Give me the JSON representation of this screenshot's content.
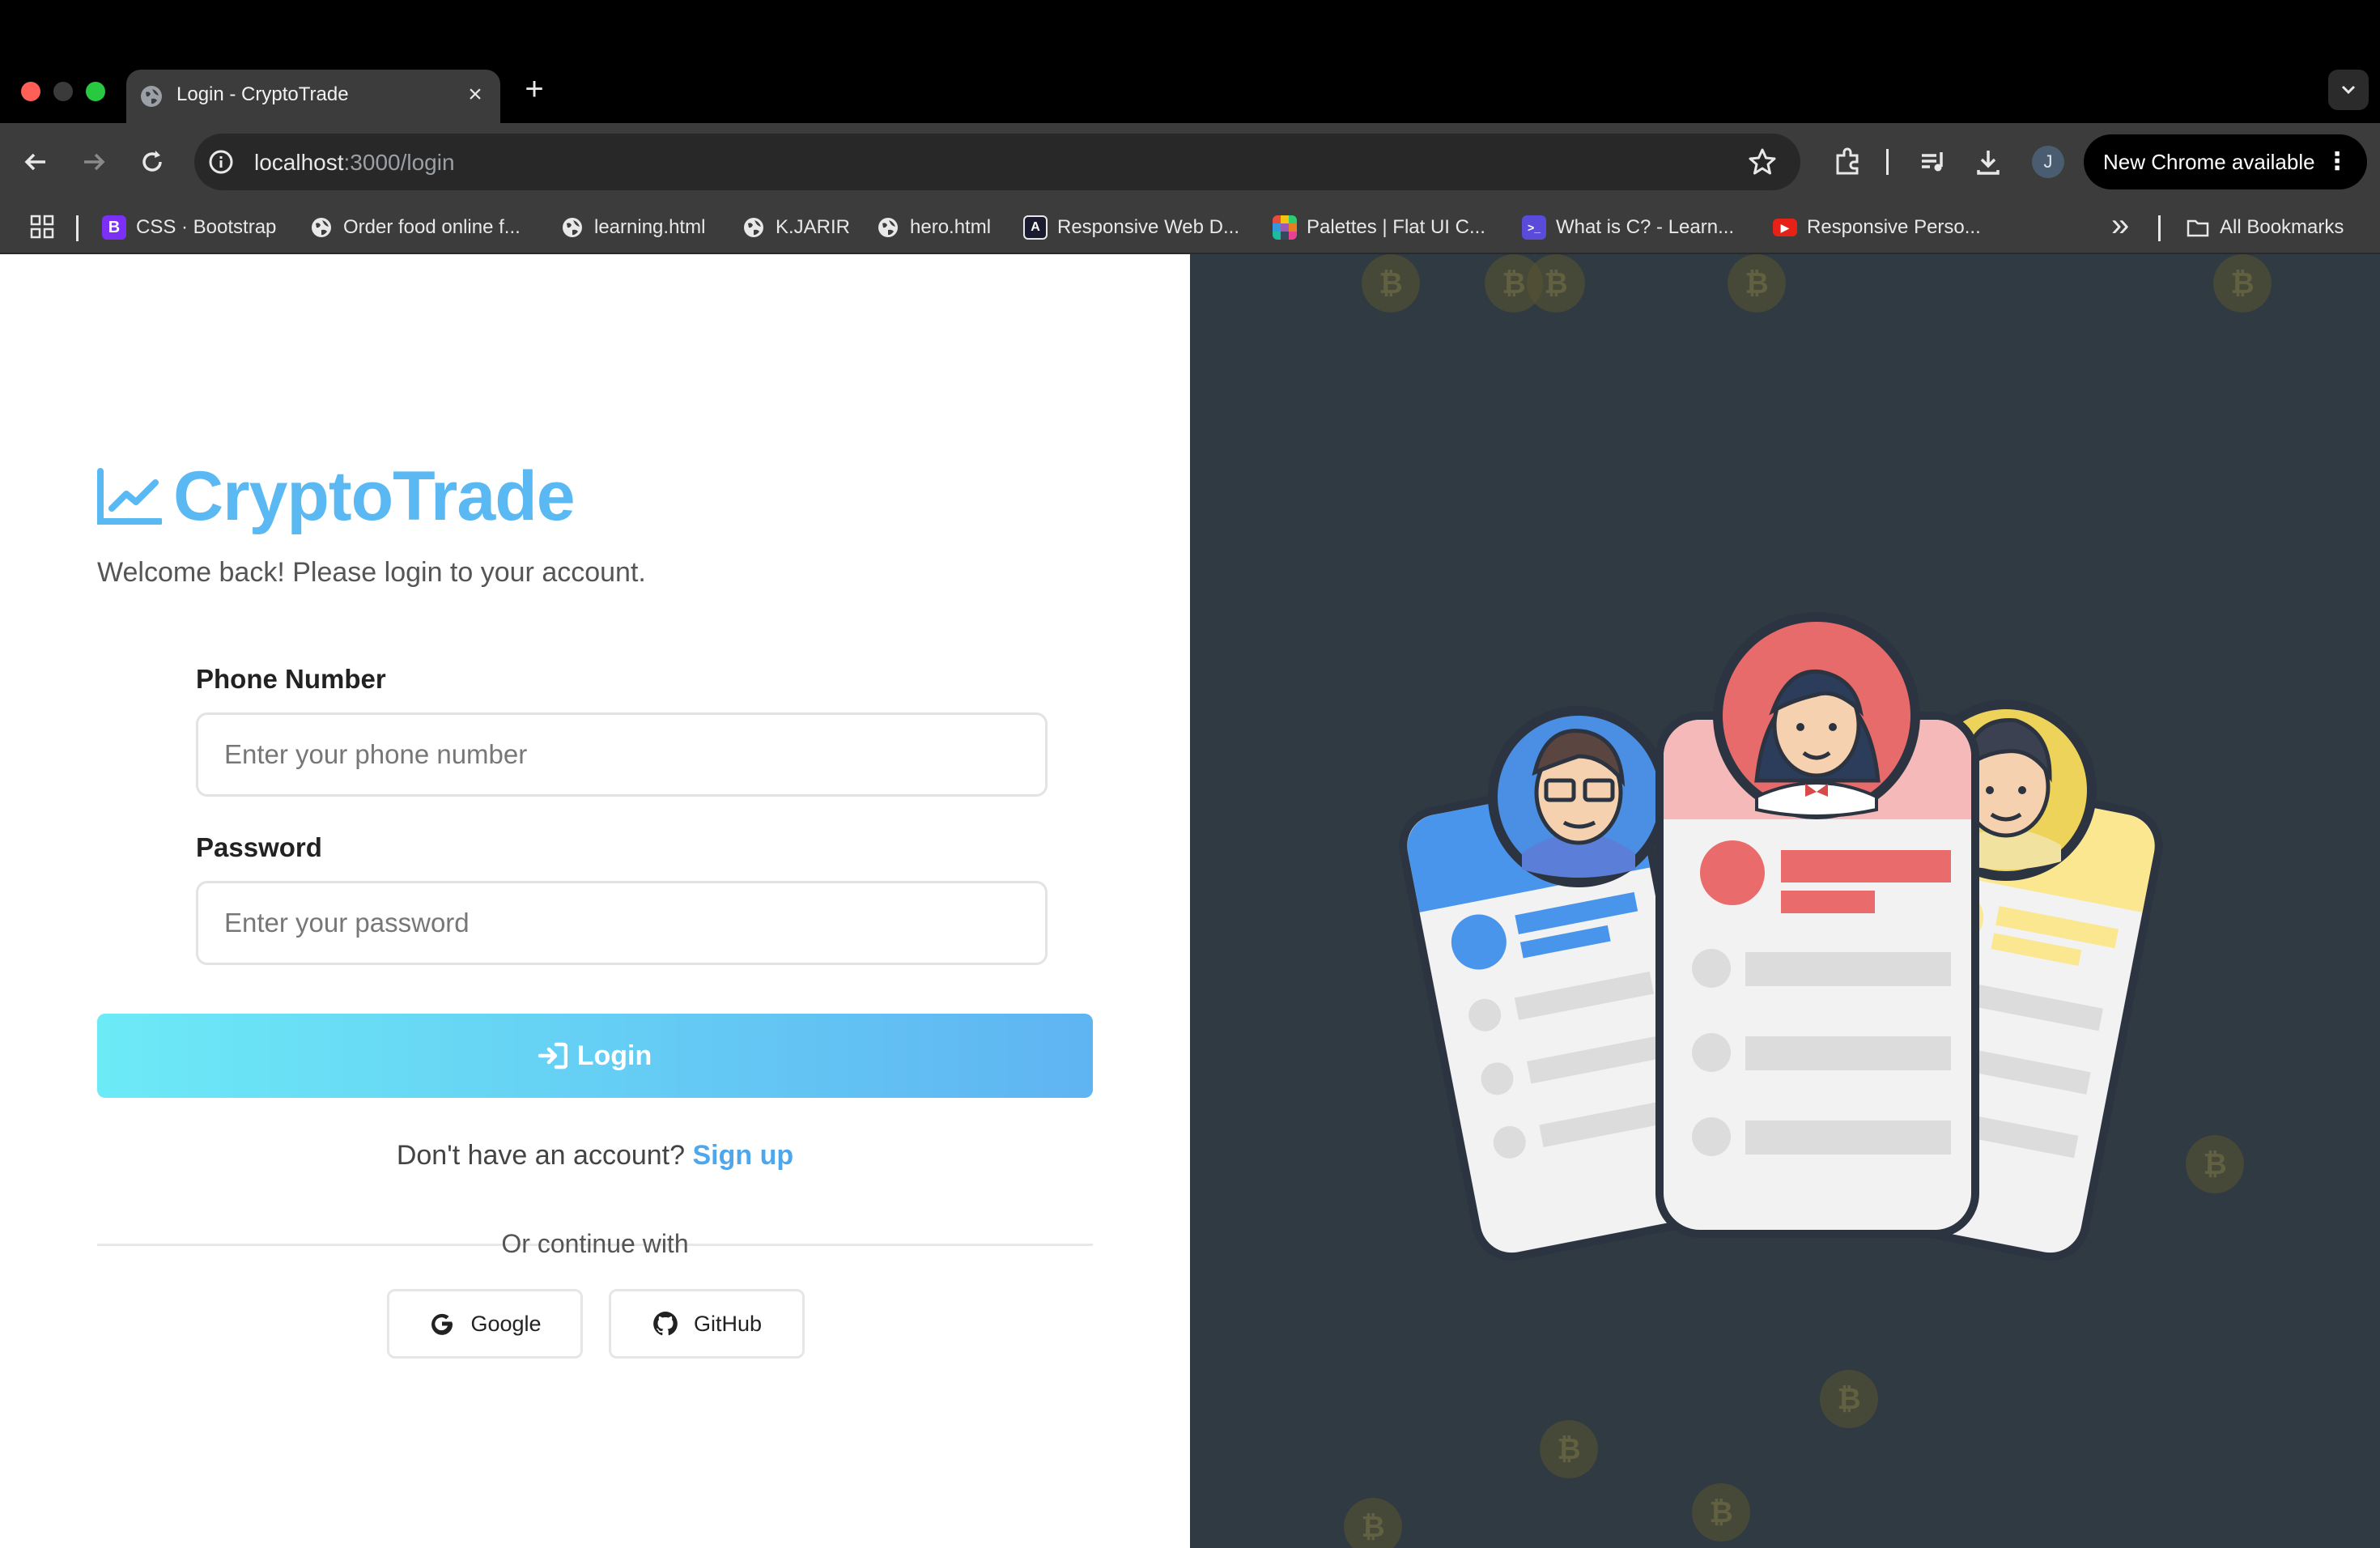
{
  "browser": {
    "tab_title": "Login - CryptoTrade",
    "url_host": "localhost",
    "url_path": ":3000/login",
    "profile_initial": "J",
    "update_label": "New Chrome available",
    "new_tab_glyph": "+",
    "close_glyph": "×",
    "kebab_glyph": "⋮",
    "overflow_glyph": "»"
  },
  "bookmarks": [
    {
      "label": "CSS · Bootstrap",
      "icon": "bootstrap-icon",
      "glyph": "B",
      "color": "#7b2ff7"
    },
    {
      "label": "Order food online f...",
      "icon": "globe-icon"
    },
    {
      "label": "learning.html",
      "icon": "globe-icon"
    },
    {
      "label": "K.JARIR",
      "icon": "globe-icon"
    },
    {
      "label": "hero.html",
      "icon": "globe-icon"
    },
    {
      "label": "Responsive Web D...",
      "icon": "a-icon",
      "glyph": "A",
      "color": "#1b1b2f"
    },
    {
      "label": "Palettes | Flat UI C...",
      "icon": "palette-icon"
    },
    {
      "label": "What is C? - Learn...",
      "icon": "terminal-icon",
      "glyph": ">_",
      "color": "#5b4bdb"
    },
    {
      "label": "Responsive Perso...",
      "icon": "youtube-icon",
      "glyph": "▶",
      "color": "#e62117"
    }
  ],
  "all_bookmarks_label": "All Bookmarks",
  "login": {
    "brand_name": "CryptoTrade",
    "welcome": "Welcome back! Please login to your account.",
    "phone_label": "Phone Number",
    "phone_placeholder": "Enter your phone number",
    "password_label": "Password",
    "password_placeholder": "Enter your password",
    "submit_label": "Login",
    "signup_prompt": "Don't have an account?",
    "signup_link": "Sign up",
    "divider_text": "Or continue with",
    "google_label": "Google",
    "github_label": "GitHub"
  },
  "coin_glyph": "₿",
  "colors": {
    "brand": "#5ab8f2",
    "button_gradient_start": "#6ceaf6",
    "button_gradient_end": "#5fb4f2",
    "link": "#4ea6ec",
    "illustration_bg": "#2f3a42"
  }
}
